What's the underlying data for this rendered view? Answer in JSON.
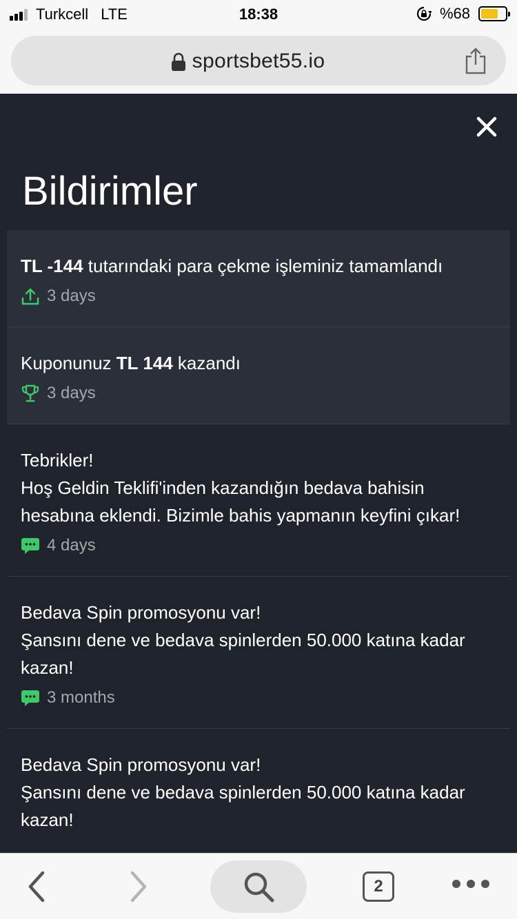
{
  "status_bar": {
    "carrier": "Turkcell",
    "network": "LTE",
    "time": "18:38",
    "battery": "%68"
  },
  "browser": {
    "url": "sportsbet55.io",
    "tab_count": "2"
  },
  "page": {
    "title": "Bildirimler"
  },
  "notifications": [
    {
      "pre": "",
      "bold": "TL -144",
      "post": " tutarındaki para çekme işleminiz tamamlandı",
      "time": "3 days",
      "icon": "upload-icon",
      "highlighted": true
    },
    {
      "pre": "Kuponunuz ",
      "bold": "TL 144",
      "post": " kazandı",
      "time": "3 days",
      "icon": "trophy-icon",
      "highlighted": true
    },
    {
      "line1": "Tebrikler!",
      "line2": "Hoş Geldin Teklifi'inden kazandığın bedava bahisin hesabına eklendi. Bizimle bahis yapmanın keyfini çıkar!",
      "time": "4 days",
      "icon": "chat-icon"
    },
    {
      "line1": "Bedava Spin promosyonu var!",
      "line2": "Şansını dene ve bedava spinlerden 50.000 katına kadar kazan!",
      "time": "3 months",
      "icon": "chat-icon"
    },
    {
      "line1": "Bedava Spin promosyonu var!",
      "line2": "Şansını dene ve bedava spinlerden 50.000 katına kadar kazan!",
      "icon": "chat-icon"
    }
  ],
  "colors": {
    "background": "#1f232b",
    "highlight": "#2a2f39",
    "accent_green": "#3ec86a",
    "muted_text": "#a3a7ae"
  }
}
